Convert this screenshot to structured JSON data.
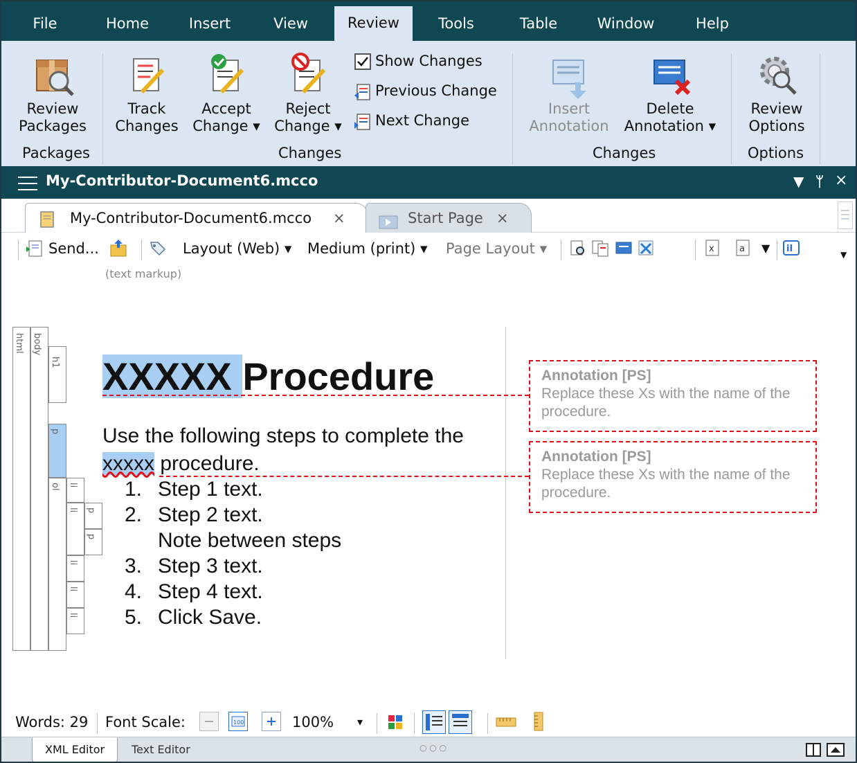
{
  "menu": [
    "File",
    "Home",
    "Insert",
    "View",
    "Review",
    "Tools",
    "Table",
    "Window",
    "Help"
  ],
  "active_menu": "Review",
  "ribbon": {
    "review_packages": [
      "Review",
      "Packages"
    ],
    "track_changes": [
      "Track",
      "Changes"
    ],
    "accept_change": [
      "Accept",
      "Change ▾"
    ],
    "reject_change": [
      "Reject",
      "Change ▾"
    ],
    "show_changes": "Show Changes",
    "previous_change": "Previous Change",
    "next_change": "Next Change",
    "insert_annotation": [
      "Insert",
      "Annotation"
    ],
    "delete_annotation": [
      "Delete",
      "Annotation ▾"
    ],
    "review_options": [
      "Review",
      "Options"
    ],
    "groups": {
      "packages": "Packages",
      "changes1": "Changes",
      "changes2": "Changes",
      "options": "Options"
    }
  },
  "doc": {
    "title": "My-Contributor-Document6.mcco",
    "tabs": [
      {
        "label": "My-Contributor-Document6.mcco",
        "close": "×"
      },
      {
        "label": "Start Page",
        "close": "×"
      }
    ]
  },
  "toolbar": {
    "send": "Send...",
    "layout": "Layout (Web) ▾",
    "medium": "Medium (print) ▾",
    "page_layout": "Page Layout ▾"
  },
  "editor": {
    "markup_label": "(text markup)",
    "tags": {
      "html": "html",
      "body": "body",
      "h1": "h1",
      "p1": "p",
      "ol": "ol",
      "li": "li",
      "p2": "p",
      "p3": "p"
    },
    "heading_highlight": "XXXXX ",
    "heading_rest": "Procedure",
    "para_line1": "Use the following steps to complete the",
    "para_highlight": "xxxxx",
    "para_rest": " procedure.",
    "steps_a": [
      {
        "n": "1.",
        "t": "Step 1 text."
      },
      {
        "n": "2.",
        "t": "Step 2 text."
      }
    ],
    "note": "Note between steps",
    "steps_b": [
      {
        "n": "3.",
        "t": "Step 3 text."
      },
      {
        "n": "4.",
        "t": "Step 4 text."
      },
      {
        "n": "5.",
        "t": "Click Save."
      }
    ],
    "annotations": [
      {
        "title": "Annotation [PS]",
        "body": "Replace these Xs with the name of the procedure."
      },
      {
        "title": "Annotation [PS]",
        "body": "Replace these Xs with the name of the procedure."
      }
    ]
  },
  "status": {
    "words": "Words: 29",
    "font_scale": "Font Scale:",
    "zoom": "100%",
    "zoom_arrow": "▾",
    "dots": "○ ○ ○"
  },
  "bottom_tabs": [
    "XML Editor",
    "Text Editor"
  ],
  "colors": {
    "title_bar": "#0f4753",
    "ribbon": "#dbe6f2",
    "highlight": "#a8cef4",
    "annotation_border": "#e0101a"
  }
}
